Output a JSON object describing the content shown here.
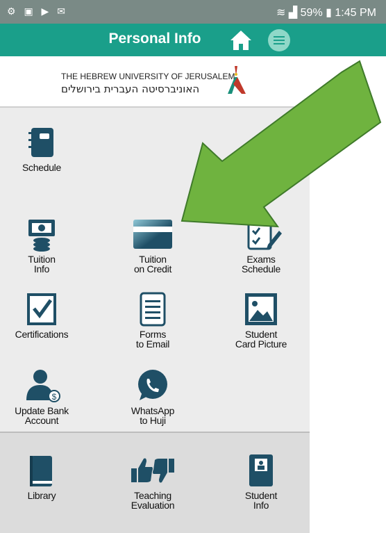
{
  "status_bar": {
    "left_icons": "⚙ ▣ ▶ ✉",
    "battery_percent": "59%",
    "time": "1:45 PM"
  },
  "app_bar": {
    "title": "Personal Info",
    "home_icon": "home-icon",
    "menu_icon": "menu-icon"
  },
  "logo": {
    "english": "THE HEBREW UNIVERSITY OF JERUSALEM",
    "hebrew": "האוניברסיטה העברית בירושלים"
  },
  "tiles": [
    {
      "id": "schedule",
      "label": "Schedule",
      "icon": "notebook-icon"
    },
    {
      "id": "tuition-info",
      "label": "Tuition\nInfo",
      "icon": "money-icon"
    },
    {
      "id": "tuition-credit",
      "label": "Tuition\non Credit",
      "icon": "credit-card-icon"
    },
    {
      "id": "exams-schedule",
      "label": "Exams\nSchedule",
      "icon": "checklist-icon"
    },
    {
      "id": "certifications",
      "label": "Certifications",
      "icon": "checkbox-icon"
    },
    {
      "id": "forms-email",
      "label": "Forms\nto Email",
      "icon": "document-icon"
    },
    {
      "id": "student-card",
      "label": "Student\nCard Picture",
      "icon": "picture-icon"
    },
    {
      "id": "update-bank",
      "label": "Update Bank\nAccount",
      "icon": "person-dollar-icon"
    },
    {
      "id": "whatsapp",
      "label": "WhatsApp\nto Huji",
      "icon": "whatsapp-icon"
    }
  ],
  "bottom_tiles": [
    {
      "id": "library",
      "label": "Library",
      "icon": "book-icon"
    },
    {
      "id": "teaching-eval",
      "label": "Teaching\nEvaluation",
      "icon": "thumbs-icon"
    },
    {
      "id": "student-info",
      "label": "Student\nInfo",
      "icon": "id-card-icon"
    }
  ],
  "colors": {
    "teal": "#1a9f8a",
    "icon_dark": "#1f4f66",
    "arrow_green": "#6fb33f"
  }
}
